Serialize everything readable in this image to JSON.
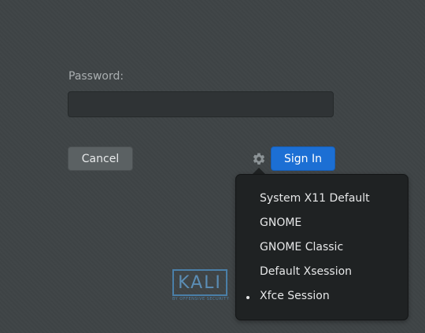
{
  "login": {
    "password_label": "Password:",
    "password_value": "",
    "cancel_label": "Cancel",
    "signin_label": "Sign In"
  },
  "session_menu": {
    "icon": "gear-icon",
    "items": [
      {
        "label": "System X11 Default",
        "selected": false
      },
      {
        "label": "GNOME",
        "selected": false
      },
      {
        "label": "GNOME Classic",
        "selected": false
      },
      {
        "label": "Default Xsession",
        "selected": false
      },
      {
        "label": "Xfce Session",
        "selected": true
      }
    ]
  },
  "branding": {
    "logo_text": "KALI",
    "tagline": "BY OFFENSIVE SECURITY"
  },
  "colors": {
    "background": "#3f4446",
    "accent": "#1c6fd4",
    "popover": "#1f2223"
  }
}
